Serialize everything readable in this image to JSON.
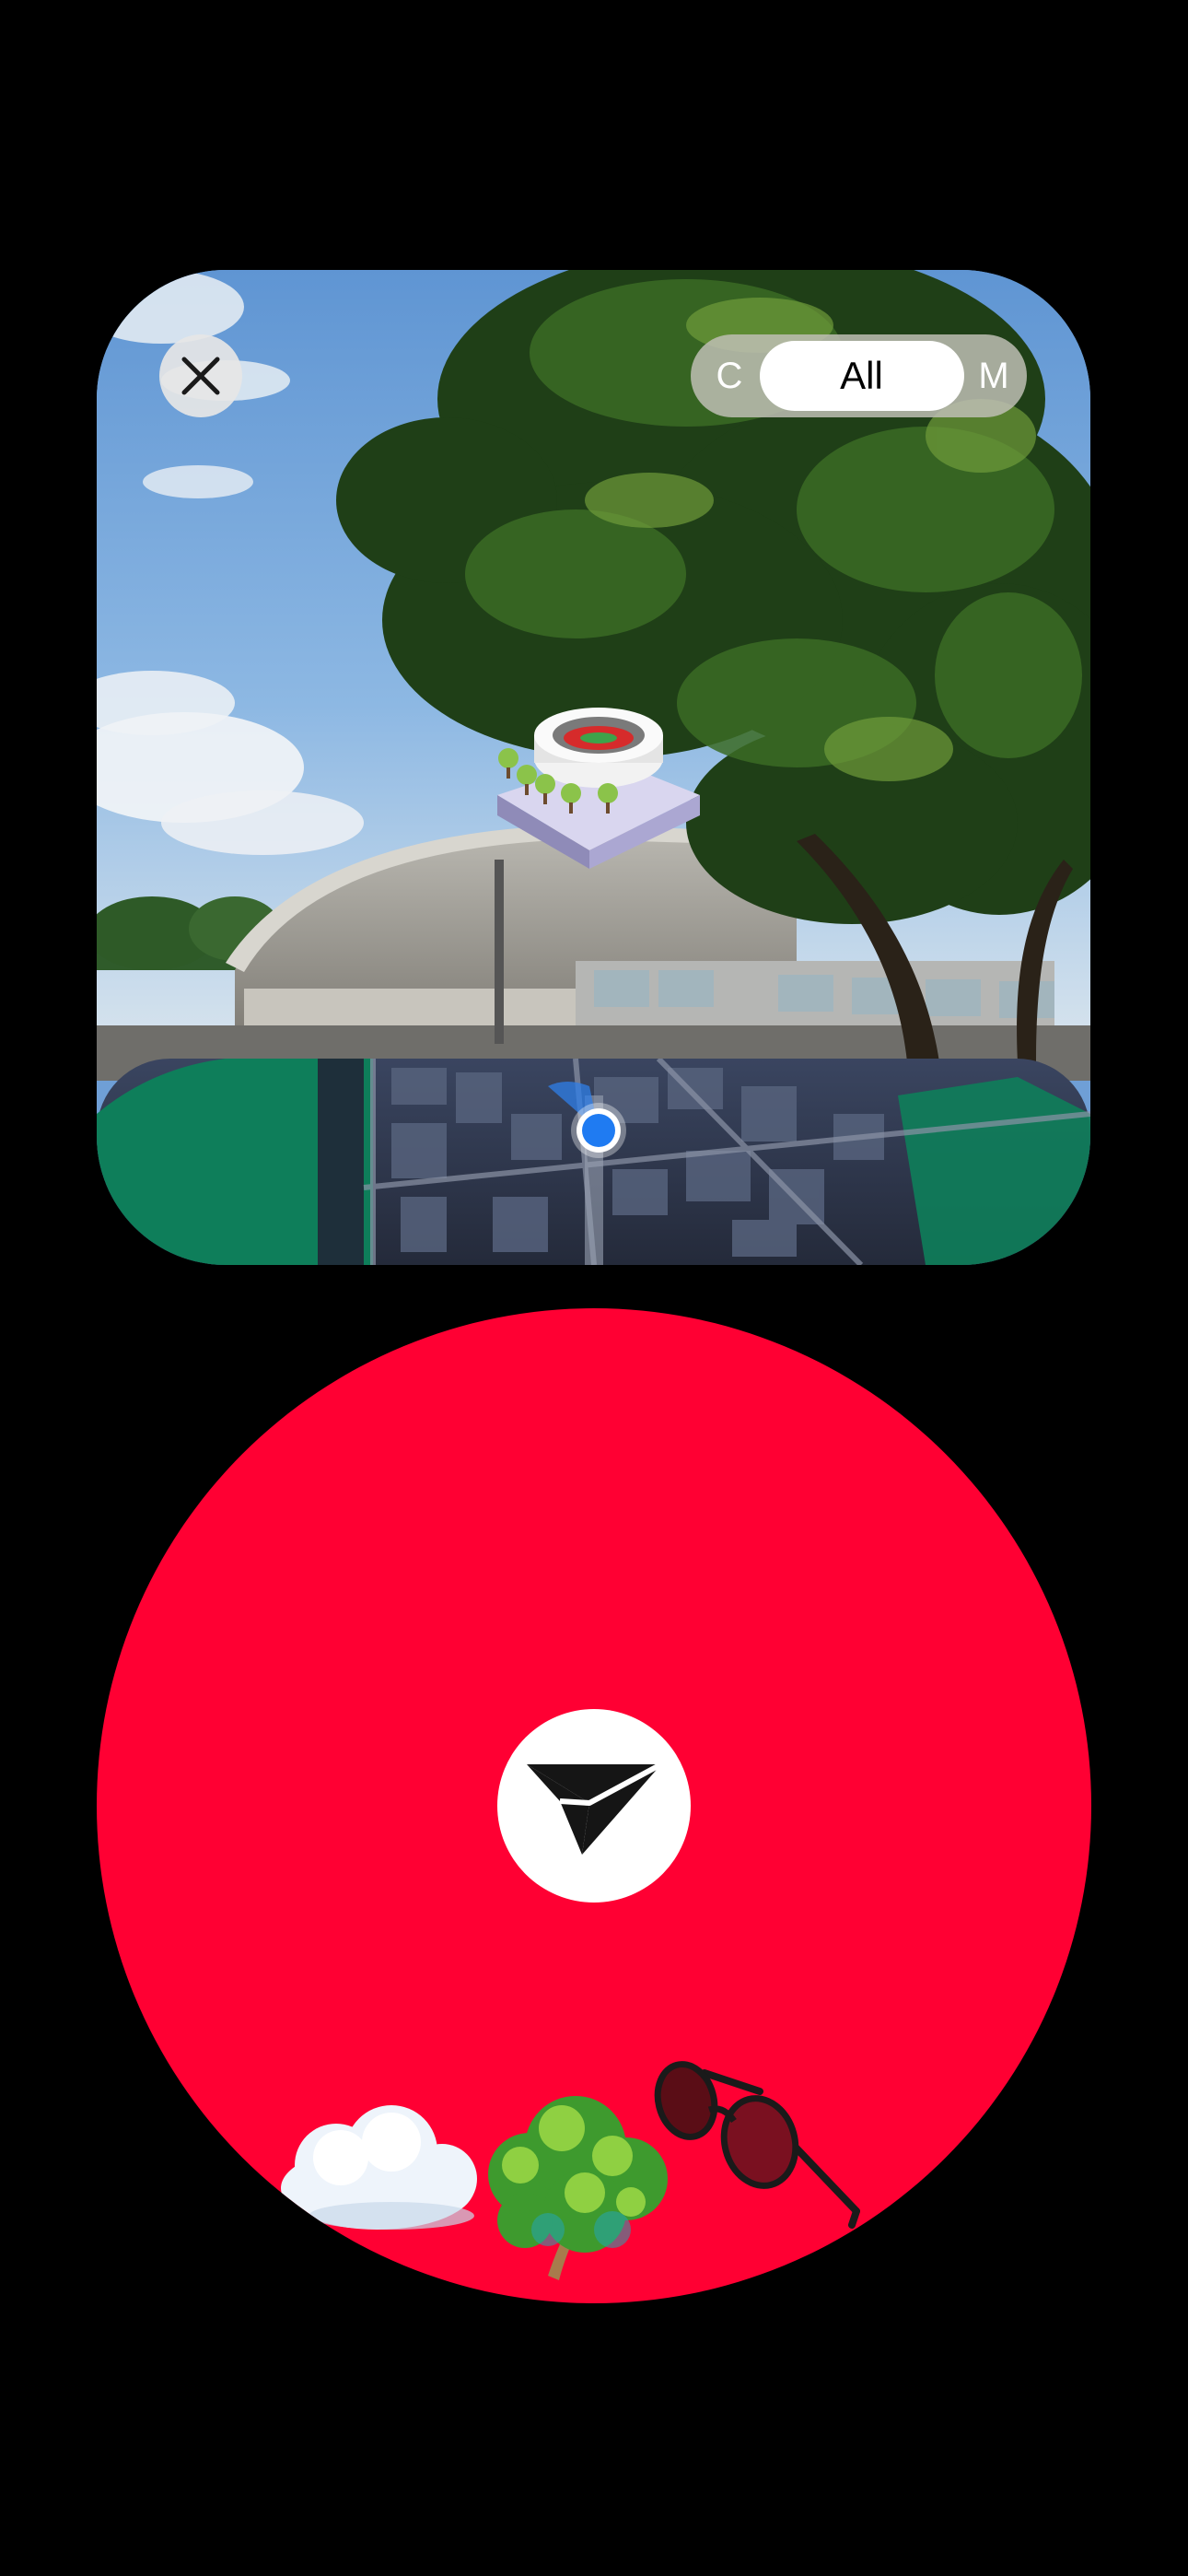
{
  "camera_view": {
    "close_icon": "close-icon",
    "mode_switch": {
      "options": [
        "C",
        "All",
        "M"
      ],
      "selected": "All"
    },
    "stadium_marker_icon": "stadium-3d-icon",
    "map": {
      "user_location_icon": "user-location-dot-icon"
    }
  },
  "send_panel": {
    "background_color": "#ff0033",
    "send_icon": "paper-plane-icon",
    "stickers": [
      "cloud-sticker",
      "tree-sticker",
      "sunglasses-sticker"
    ]
  }
}
